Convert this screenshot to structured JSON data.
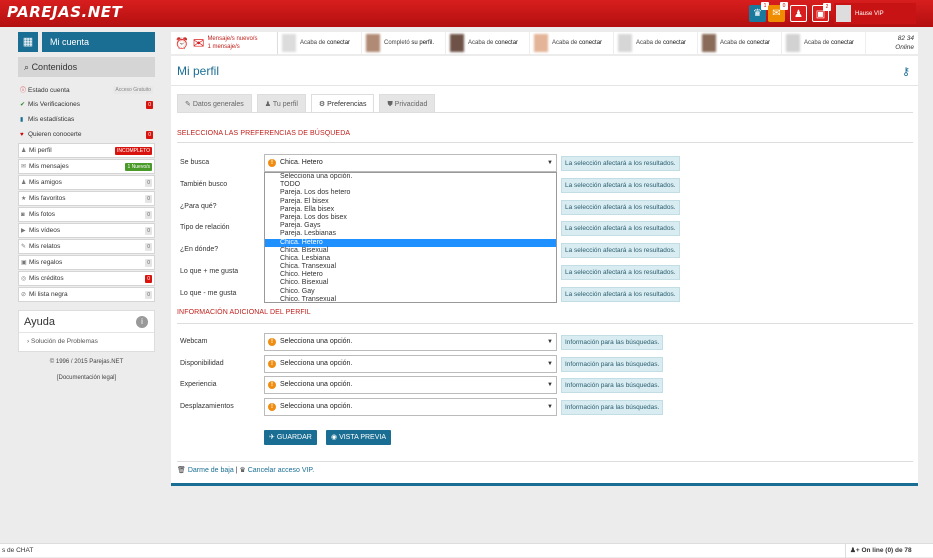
{
  "header": {
    "logo": "PAREJAS.NET",
    "user_name": "Hause VIP",
    "badge_1": "1",
    "badge_2": "0",
    "badge_3": "2"
  },
  "sidebar": {
    "mi_cuenta": "Mi cuenta",
    "contenidos": "Contenidos",
    "items": [
      {
        "label": "Estado cuenta",
        "badge": "Acceso Gratuito",
        "badge_type": "gr2",
        "icon": "info-icon"
      },
      {
        "label": "Mis Verificaciones",
        "badge": "0",
        "badge_type": "r",
        "icon": "check-icon"
      },
      {
        "label": "Mis estadísticas",
        "badge": "",
        "badge_type": "",
        "icon": "bar-chart-icon"
      },
      {
        "label": "Quieren conocerte",
        "badge": "0",
        "badge_type": "r",
        "icon": "heart-icon"
      },
      {
        "label": "Mi perfil",
        "badge": "INCOMPLETO",
        "badge_type": "r",
        "icon": "user-icon"
      },
      {
        "label": "Mis mensajes",
        "badge": "1 Nuevo/s",
        "badge_type": "g",
        "icon": "envelope-icon"
      },
      {
        "label": "Mis amigos",
        "badge": "0",
        "badge_type": "gr",
        "icon": "users-icon"
      },
      {
        "label": "Mis favoritos",
        "badge": "0",
        "badge_type": "gr",
        "icon": "star-icon"
      },
      {
        "label": "Mis fotos",
        "badge": "0",
        "badge_type": "gr",
        "icon": "camera-icon"
      },
      {
        "label": "Mis vídeos",
        "badge": "0",
        "badge_type": "gr",
        "icon": "video-icon"
      },
      {
        "label": "Mis relatos",
        "badge": "0",
        "badge_type": "gr",
        "icon": "pencil-icon"
      },
      {
        "label": "Mis regalos",
        "badge": "0",
        "badge_type": "gr",
        "icon": "gift-icon"
      },
      {
        "label": "Mis créditos",
        "badge": "0",
        "badge_type": "r",
        "icon": "coins-icon"
      },
      {
        "label": "Mi lista negra",
        "badge": "0",
        "badge_type": "gr",
        "icon": "ban-icon"
      }
    ],
    "ayuda": "Ayuda",
    "ayuda_link": "Solución de Problemas",
    "copyright": "© 1996 / 2015 Parejas.NET",
    "doc_legal": "[Documentación legal]"
  },
  "notifications": {
    "msg_line1": "Mensaje/s nuevo/s",
    "msg_line2": "1 mensaje/s",
    "items": [
      {
        "prefix": "Acaba de",
        "action": "conectar",
        "color": "#dcdcdc"
      },
      {
        "prefix": "Completó",
        "action": "su perfil.",
        "color": "#b08a74"
      },
      {
        "prefix": "Acaba de",
        "action": "conectar",
        "color": "#6e5248"
      },
      {
        "prefix": "Acaba de",
        "action": "conectar",
        "color": "#e3b498"
      },
      {
        "prefix": "Acaba de",
        "action": "conectar",
        "color": "#d6d6d6"
      },
      {
        "prefix": "Acaba de",
        "action": "conectar",
        "color": "#8a6a58"
      },
      {
        "prefix": "Acaba de",
        "action": "conectar",
        "color": "#d2d2d2"
      }
    ],
    "online_count": "82 34",
    "online_label": "Online"
  },
  "main": {
    "title": "Mi perfil",
    "tabs": [
      "Datos generales",
      "Tu perfil",
      "Preferencias",
      "Privacidad"
    ],
    "section1": "Selecciona las preferencias de búsqueda",
    "section2": "Información adicional del perfil",
    "pref_rows": [
      {
        "label": "Se busca",
        "value": "Chica. Hetero",
        "info": "La selección afectará a los resultados."
      },
      {
        "label": "También busco",
        "value": "",
        "info": "La selección afectará a los resultados."
      },
      {
        "label": "¿Para qué?",
        "value": "",
        "info": "La selección afectará a los resultados."
      },
      {
        "label": "Tipo de relación",
        "value": "",
        "info": "La selección afectará a los resultados."
      },
      {
        "label": "¿En dónde?",
        "value": "",
        "info": "La selección afectará a los resultados."
      },
      {
        "label": "Lo que + me gusta",
        "value": "",
        "info": "La selección afectará a los resultados."
      },
      {
        "label": "Lo que - me gusta",
        "value": "",
        "info": "La selección afectará a los resultados."
      }
    ],
    "dropdown_options": [
      "Selecciona una opción.",
      "TODO",
      "Pareja. Los dos hetero",
      "Pareja. El bisex",
      "Pareja. Ella bisex",
      "Pareja. Los dos bisex",
      "Pareja. Gays",
      "Pareja. Lesbianas",
      "Chica. Hetero",
      "Chica. Bisexual",
      "Chica. Lesbiana",
      "Chica. Transexual",
      "Chico. Hetero",
      "Chico. Bisexual",
      "Chico. Gay",
      "Chico. Transexual"
    ],
    "dropdown_selected": "Chica. Hetero",
    "extra_rows": [
      {
        "label": "Webcam",
        "value": "Selecciona una opción.",
        "info": "Información para las búsquedas."
      },
      {
        "label": "Disponibilidad",
        "value": "Selecciona una opción.",
        "info": "Información para las búsquedas."
      },
      {
        "label": "Experiencia",
        "value": "Selecciona una opción.",
        "info": "Información para las búsquedas."
      },
      {
        "label": "Desplazamientos",
        "value": "Selecciona una opción.",
        "info": "Información para las búsquedas."
      }
    ],
    "save_label": "GUARDAR",
    "preview_label": "VISTA PREVIA",
    "darme_baja": "Darme de baja",
    "sep": "|",
    "cancelar_vip": "Cancelar acceso VIP."
  },
  "bottombar": {
    "chat": "s de CHAT",
    "online": "On line (0) de 78"
  }
}
